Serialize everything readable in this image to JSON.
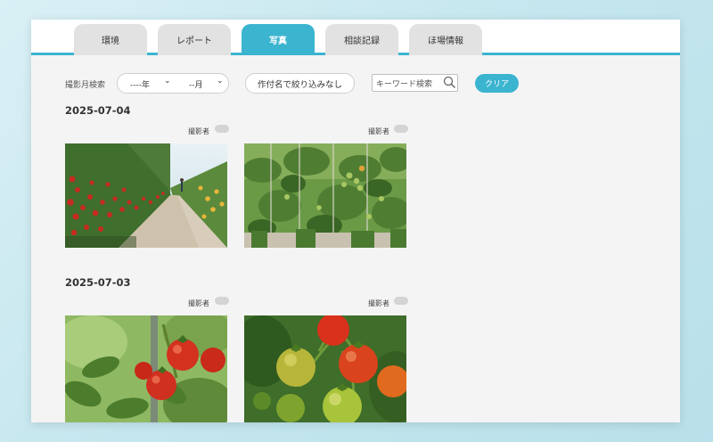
{
  "tabs": [
    {
      "label": "環境"
    },
    {
      "label": "レポート"
    },
    {
      "label": "写真"
    },
    {
      "label": "相談記録"
    },
    {
      "label": "ほ場情報"
    }
  ],
  "filter": {
    "label": "撮影月検索",
    "year_value": "----年",
    "month_value": "--月",
    "crop_button": "作付名で絞り込みなし",
    "search_placeholder": "キーワード検索",
    "clear_button": "クリア"
  },
  "groups": [
    {
      "date": "2025-07-04",
      "photos": [
        {
          "photographer_label": "撮影者",
          "subject": "greenhouse-tomato-rows"
        },
        {
          "photographer_label": "撮影者",
          "subject": "tomato-plants-green"
        }
      ]
    },
    {
      "date": "2025-07-03",
      "photos": [
        {
          "photographer_label": "撮影者",
          "subject": "tomato-cluster-closeup"
        },
        {
          "photographer_label": "撮影者",
          "subject": "ripening-tomatoes"
        }
      ]
    }
  ],
  "colors": {
    "accent": "#3bb4d0",
    "tab_inactive": "#e2e2e2",
    "content_bg": "#f4f4f4"
  }
}
